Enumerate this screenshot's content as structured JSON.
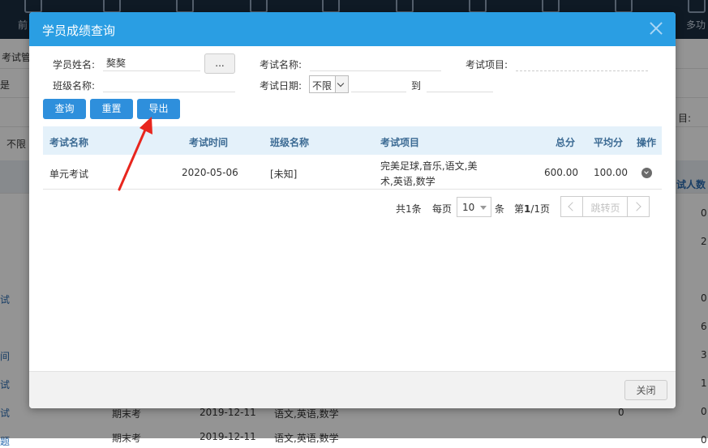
{
  "background": {
    "topbar_labels": [
      "前",
      "多功"
    ],
    "left_labels": [
      "考试管",
      "是",
      "不限",
      "试",
      "间",
      "试",
      "试",
      "题"
    ],
    "right_labels": [
      "目:",
      "试人数",
      "0",
      "2",
      "0",
      "6",
      "3",
      "1",
      "0",
      "0"
    ],
    "bottom_row": {
      "name": "期末考",
      "date": "2019-12-11",
      "subjects": "语文,英语,数学",
      "score": "0"
    },
    "bottom_row2": {
      "name": "期末考",
      "date": "2019-12-11",
      "subjects": "语文,英语,数学"
    }
  },
  "dialog": {
    "title": "学员成绩查询",
    "filters": {
      "student_name_label": "学员姓名:",
      "student_name_value": "獒獒",
      "dots_label": "...",
      "class_name_label": "班级名称:",
      "class_name_value": "",
      "exam_name_label": "考试名称:",
      "exam_name_value": "",
      "exam_date_label": "考试日期:",
      "exam_date_value": "不限",
      "date_to_label": "到",
      "exam_item_label": "考试项目:",
      "exam_item_value": ""
    },
    "buttons": {
      "query": "查询",
      "reset": "重置",
      "export": "导出"
    },
    "table": {
      "headers": {
        "exam_name": "考试名称",
        "exam_time": "考试时间",
        "class_name": "班级名称",
        "exam_items": "考试项目",
        "total": "总分",
        "average": "平均分",
        "action": "操作"
      },
      "rows": [
        {
          "exam_name": "单元考试",
          "exam_time": "2020-05-06",
          "class_name": "[未知]",
          "exam_items_line1": "完美足球,音乐,语文,美",
          "exam_items_line2": "术,英语,数学",
          "total": "600.00",
          "average": "100.00"
        }
      ]
    },
    "pager": {
      "total_text": "共1条",
      "per_page_label": "每页",
      "per_page_value": "10",
      "unit": "条",
      "page_text_prefix": "第",
      "page_current": "1",
      "page_text_suffix": "/1页",
      "jump_label": "跳转页"
    },
    "footer": {
      "close": "关闭"
    }
  },
  "colors": {
    "header_blue": "#2a9ee3",
    "button_blue": "#2e8fdc",
    "annotation_red": "#e8261e",
    "table_header_bg": "#e4f1fa"
  }
}
